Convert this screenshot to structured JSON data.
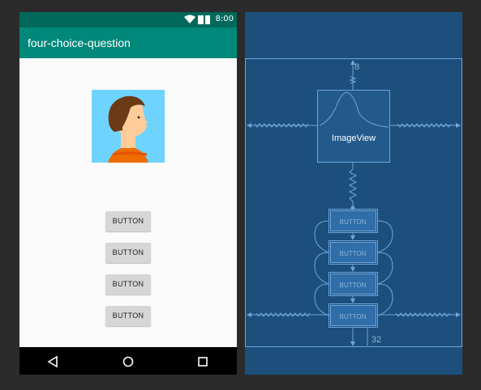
{
  "design": {
    "status_time": "8:00",
    "app_title": "four-choice-question",
    "buttons": [
      "BUTTON",
      "BUTTON",
      "BUTTON",
      "BUTTON"
    ]
  },
  "blueprint": {
    "imageview_label": "ImageView",
    "button_labels": [
      "BUTTON",
      "BUTTON",
      "BUTTON",
      "BUTTON"
    ],
    "top_margin": "8",
    "bottom_margin": "32"
  },
  "colors": {
    "status_bar": "#00695c",
    "app_bar": "#00897b",
    "blueprint_bg": "#1d4f7c",
    "blueprint_line": "#6ea6dc"
  }
}
